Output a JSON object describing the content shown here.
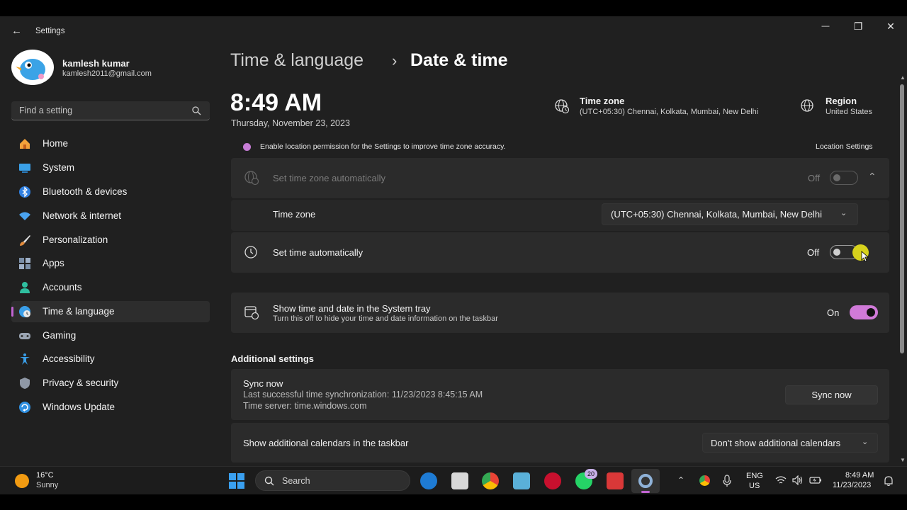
{
  "titlebar": {
    "app_name": "Settings",
    "minimize_glyph": "—",
    "maximize_glyph": "❐",
    "close_glyph": "✕"
  },
  "profile": {
    "name": "kamlesh kumar",
    "email": "kamlesh2011@gmail.com"
  },
  "search": {
    "placeholder": "Find a setting"
  },
  "sidebar": {
    "items": [
      {
        "label": "Home",
        "icon": "home-icon",
        "color": "#f2a23b"
      },
      {
        "label": "System",
        "icon": "system-icon",
        "color": "#3aa0e8"
      },
      {
        "label": "Bluetooth & devices",
        "icon": "bluetooth-icon",
        "color": "#2f7fe0"
      },
      {
        "label": "Network & internet",
        "icon": "wifi-icon",
        "color": "#4aa3f0"
      },
      {
        "label": "Personalization",
        "icon": "brush-icon",
        "color": "#e08a3c"
      },
      {
        "label": "Apps",
        "icon": "apps-icon",
        "color": "#7b8fa8"
      },
      {
        "label": "Accounts",
        "icon": "accounts-icon",
        "color": "#2fbfa0"
      },
      {
        "label": "Time & language",
        "icon": "globe-clock-icon",
        "color": "#3a9ee8"
      },
      {
        "label": "Gaming",
        "icon": "gamepad-icon",
        "color": "#9aa4b2"
      },
      {
        "label": "Accessibility",
        "icon": "accessibility-icon",
        "color": "#3a9ee8"
      },
      {
        "label": "Privacy & security",
        "icon": "shield-icon",
        "color": "#8f98a6"
      },
      {
        "label": "Windows Update",
        "icon": "update-icon",
        "color": "#2f8fe0"
      }
    ],
    "active_index": 7
  },
  "breadcrumb": {
    "parent": "Time & language",
    "separator": "›",
    "current": "Date & time"
  },
  "clock": {
    "time": "8:49 AM",
    "date": "Thursday, November 23, 2023"
  },
  "timezone_info": {
    "title": "Time zone",
    "value": "(UTC+05:30) Chennai, Kolkata, Mumbai, New Delhi"
  },
  "region_info": {
    "title": "Region",
    "value": "United States"
  },
  "notice": {
    "text": "Enable location permission for the Settings to improve time zone accuracy.",
    "link": "Location Settings"
  },
  "set_timezone_auto": {
    "label": "Set time zone automatically",
    "state": "Off"
  },
  "timezone_row": {
    "label": "Time zone",
    "value": "(UTC+05:30) Chennai, Kolkata, Mumbai, New Delhi"
  },
  "set_time_auto": {
    "label": "Set time automatically",
    "state": "Off"
  },
  "show_tray": {
    "label": "Show time and date in the System tray",
    "description": "Turn this off to hide your time and date information on the taskbar",
    "state": "On"
  },
  "additional": {
    "heading": "Additional settings",
    "sync": {
      "title": "Sync now",
      "last_sync": "Last successful time synchronization: 11/23/2023 8:45:15 AM",
      "server": "Time server: time.windows.com",
      "button": "Sync now"
    },
    "calendars": {
      "label": "Show additional calendars in the taskbar",
      "value": "Don't show additional calendars"
    }
  },
  "taskbar": {
    "weather": {
      "temp": "16°C",
      "condition": "Sunny"
    },
    "search_label": "Search",
    "whatsapp_badge": "20",
    "lang_line1": "ENG",
    "lang_line2": "US",
    "time": "8:49 AM",
    "date": "11/23/2023"
  },
  "colors": {
    "accent": "#c264d2",
    "toggle_on": "#d07ad8",
    "background": "#202020",
    "card": "#2b2b2b"
  }
}
